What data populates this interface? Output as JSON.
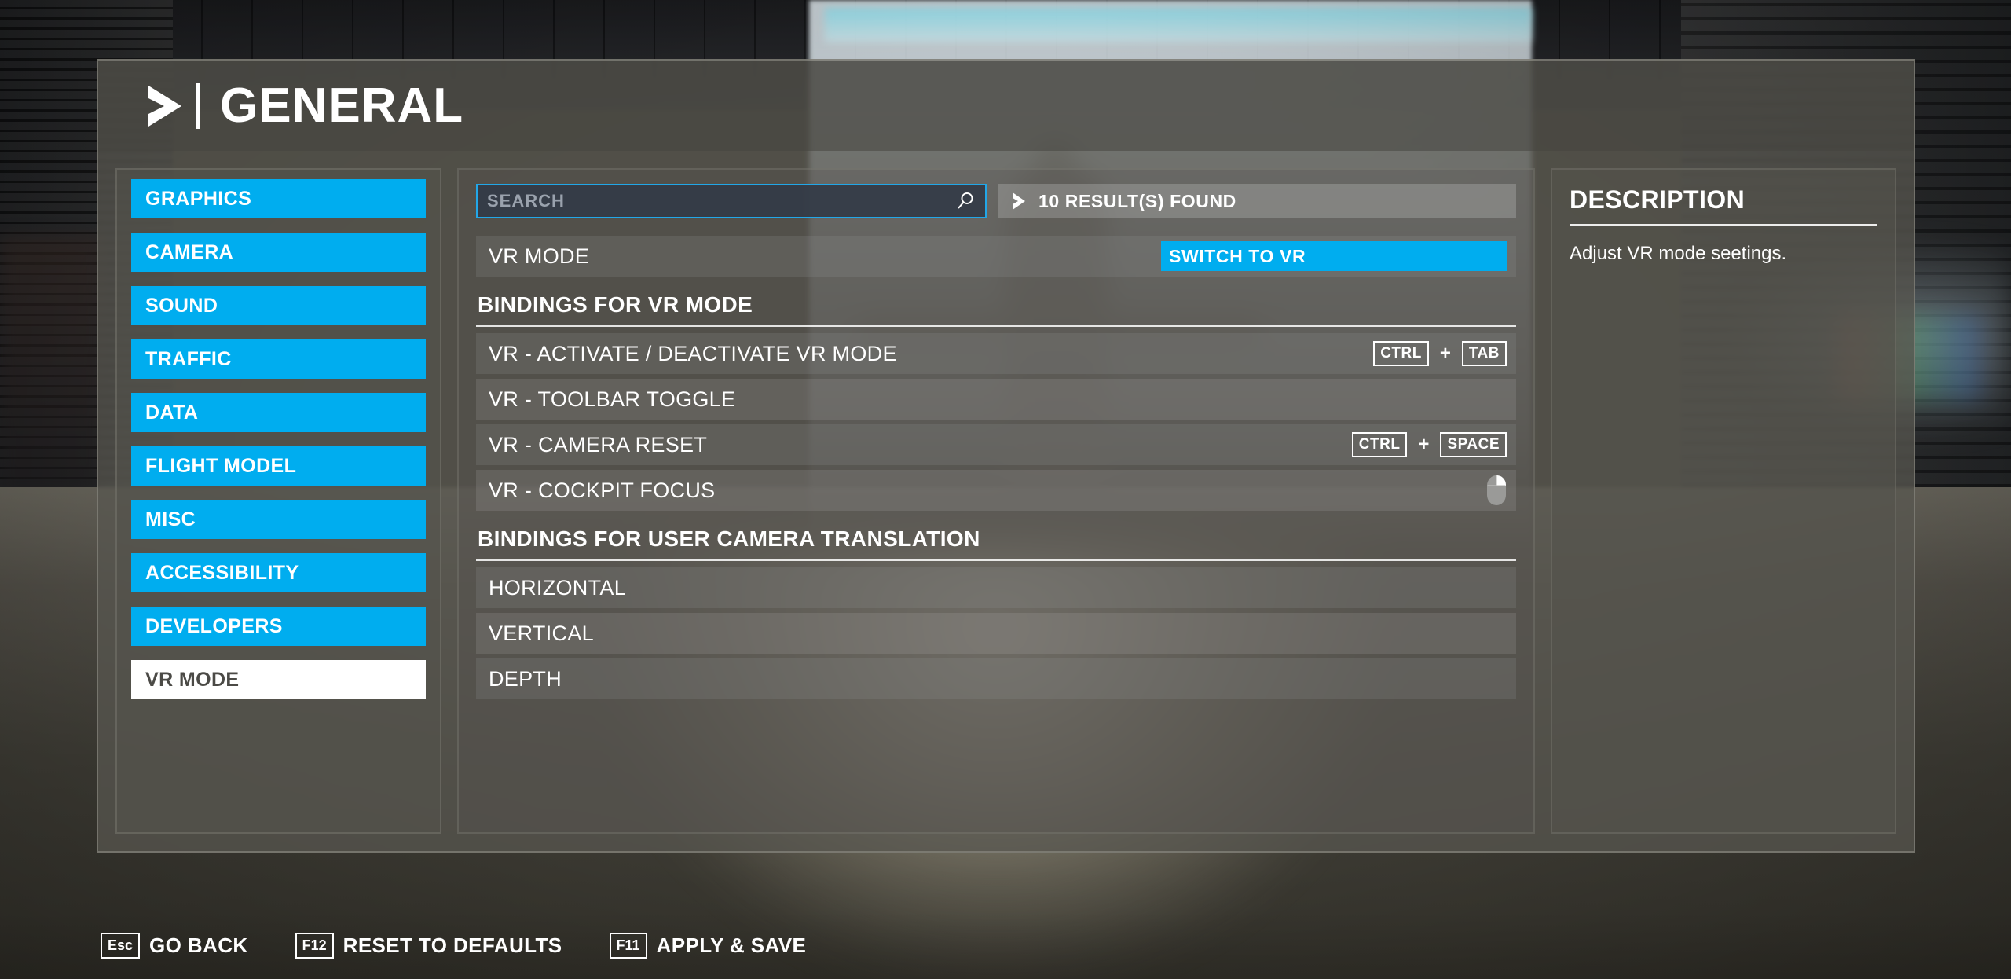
{
  "header": {
    "title": "GENERAL",
    "chevron_icon": "chevron-right-icon"
  },
  "sidebar": {
    "items": [
      {
        "label": "GRAPHICS",
        "selected": false
      },
      {
        "label": "CAMERA",
        "selected": false
      },
      {
        "label": "SOUND",
        "selected": false
      },
      {
        "label": "TRAFFIC",
        "selected": false
      },
      {
        "label": "DATA",
        "selected": false
      },
      {
        "label": "FLIGHT MODEL",
        "selected": false
      },
      {
        "label": "MISC",
        "selected": false
      },
      {
        "label": "ACCESSIBILITY",
        "selected": false
      },
      {
        "label": "DEVELOPERS",
        "selected": false
      },
      {
        "label": "VR MODE",
        "selected": true
      }
    ]
  },
  "search": {
    "placeholder": "SEARCH",
    "value": "",
    "icon": "search-icon",
    "results_text": "10 RESULT(S) FOUND",
    "results_chevron_icon": "chevron-right-icon"
  },
  "settings": {
    "vr_mode_row": {
      "label": "VR MODE",
      "button_label": "SWITCH TO VR"
    },
    "sections": [
      {
        "title": "BINDINGS FOR VR MODE",
        "rows": [
          {
            "label": "VR - ACTIVATE / DEACTIVATE VR MODE",
            "keys": [
              "CTRL",
              "TAB"
            ],
            "binding_type": "keys"
          },
          {
            "label": "VR - TOOLBAR TOGGLE",
            "keys": [],
            "binding_type": "none"
          },
          {
            "label": "VR - CAMERA RESET",
            "keys": [
              "CTRL",
              "SPACE"
            ],
            "binding_type": "keys"
          },
          {
            "label": "VR - COCKPIT FOCUS",
            "keys": [],
            "binding_type": "mouse",
            "mouse_icon": "mouse-right-button-icon"
          }
        ]
      },
      {
        "title": "BINDINGS FOR USER CAMERA TRANSLATION",
        "rows": [
          {
            "label": "HORIZONTAL",
            "keys": [],
            "binding_type": "none"
          },
          {
            "label": "VERTICAL",
            "keys": [],
            "binding_type": "none"
          },
          {
            "label": "DEPTH",
            "keys": [],
            "binding_type": "none"
          }
        ]
      }
    ]
  },
  "description": {
    "title": "DESCRIPTION",
    "body": "Adjust VR mode seetings."
  },
  "footer": {
    "actions": [
      {
        "key": "Esc",
        "label": "GO BACK"
      },
      {
        "key": "F12",
        "label": "RESET TO DEFAULTS"
      },
      {
        "key": "F11",
        "label": "APPLY & SAVE"
      }
    ]
  },
  "colors": {
    "accent": "#00adef",
    "selected_bg": "#ffffff",
    "text": "#ffffff"
  }
}
